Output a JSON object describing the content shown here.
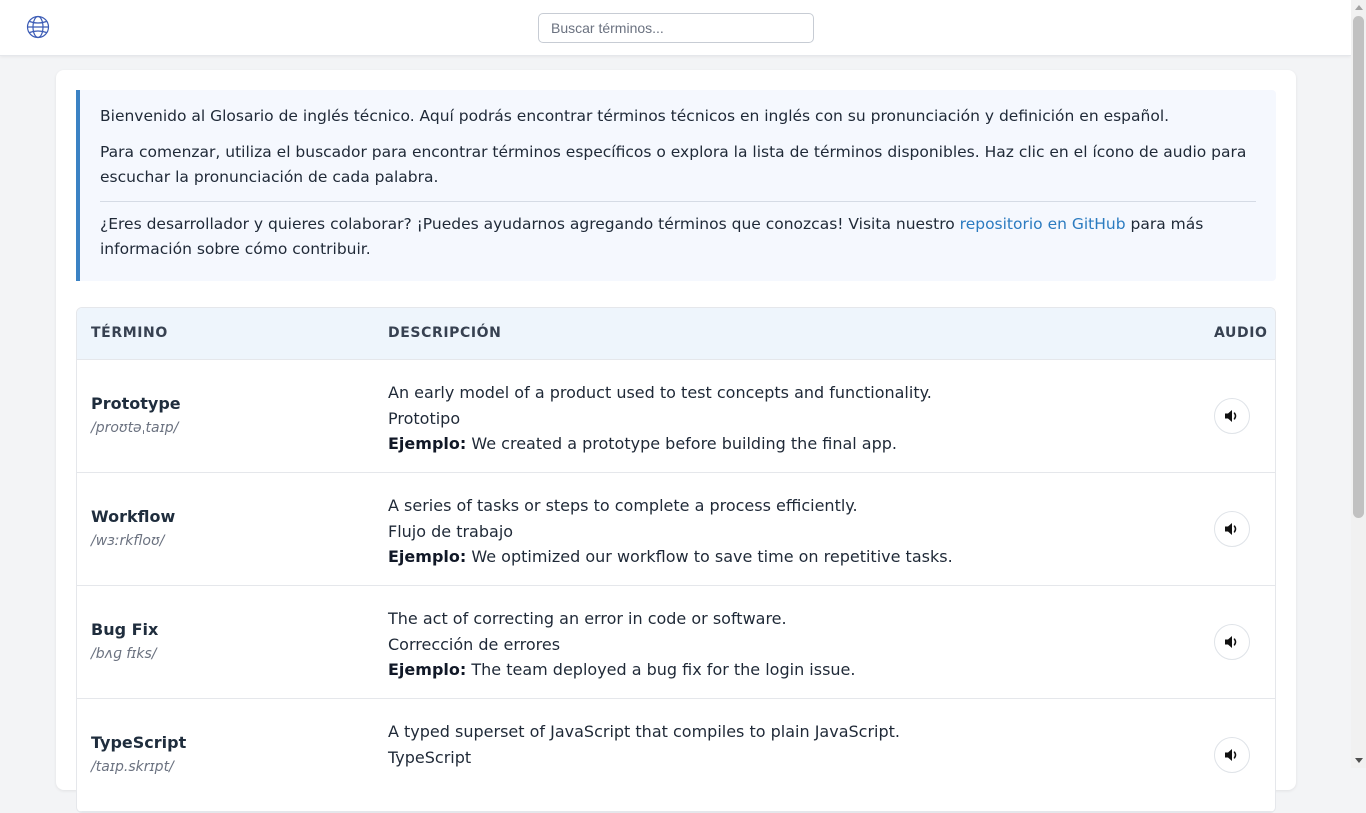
{
  "search": {
    "placeholder": "Buscar términos..."
  },
  "intro": {
    "welcome": "Bienvenido al Glosario de inglés técnico. Aquí podrás encontrar términos técnicos en inglés con su pronunciación y definición en español.",
    "instructions": "Para comenzar, utiliza el buscador para encontrar términos específicos o explora la lista de términos disponibles. Haz clic en el ícono de audio para escuchar la pronunciación de cada palabra.",
    "collab_before": "¿Eres desarrollador y quieres colaborar? ¡Puedes ayudarnos agregando términos que conozcas! Visita nuestro ",
    "collab_link": "repositorio en GitHub",
    "collab_after": " para más información sobre cómo contribuir."
  },
  "table": {
    "headers": {
      "term": "TÉRMINO",
      "description": "DESCRIPCIÓN",
      "audio": "AUDIO"
    },
    "example_label": "Ejemplo:",
    "rows": [
      {
        "term": "Prototype",
        "ipa": "/proʊtəˌtaɪp/",
        "definition": "An early model of a product used to test concepts and functionality.",
        "translation": "Prototipo",
        "example": "We created a prototype before building the final app."
      },
      {
        "term": "Workflow",
        "ipa": "/wɜːrkfloʊ/",
        "definition": "A series of tasks or steps to complete a process efficiently.",
        "translation": "Flujo de trabajo",
        "example": "We optimized our workflow to save time on repetitive tasks."
      },
      {
        "term": "Bug Fix",
        "ipa": "/bʌɡ fɪks/",
        "definition": "The act of correcting an error in code or software.",
        "translation": "Corrección de errores",
        "example": "The team deployed a bug fix for the login issue."
      },
      {
        "term": "TypeScript",
        "ipa": "/taɪp.skrɪpt/",
        "definition": "A typed superset of JavaScript that compiles to plain JavaScript.",
        "translation": "TypeScript",
        "example": ""
      }
    ]
  },
  "icons": {
    "logo": "globe-icon",
    "audio": "speaker-icon"
  },
  "colors": {
    "accent": "#3b82c4",
    "link": "#2b7bc0",
    "header_bg": "#eef5fc"
  }
}
